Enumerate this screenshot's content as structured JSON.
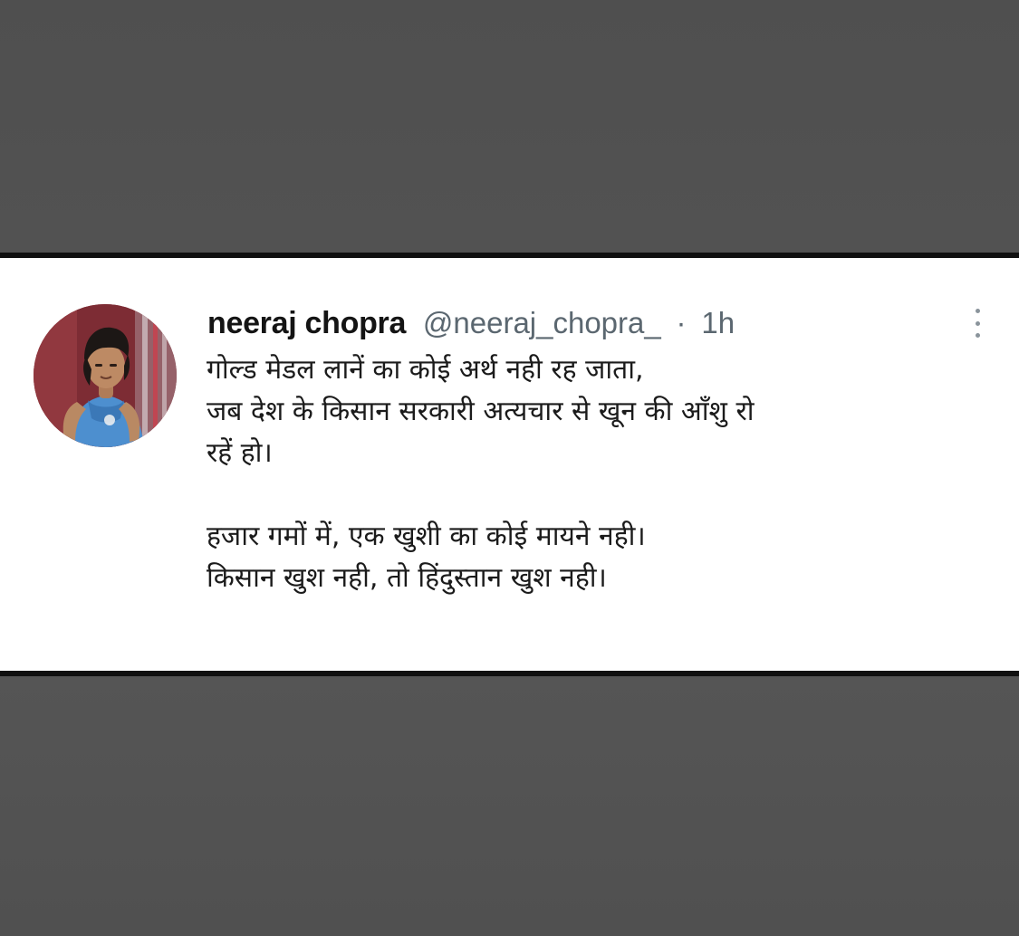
{
  "tweet": {
    "display_name": "neeraj chopra",
    "handle": "@neeraj_chopra_",
    "separator": "·",
    "time": "1h",
    "avatar_icon": "profile-avatar",
    "more_icon": "more-vertical-icon",
    "text_lines": [
      "गोल्ड मेडल लानें का कोई अर्थ नही रह जाता,",
      "जब देश के किसान सरकारी अत्यचार से खून की आँशु रो",
      "रहें हो।",
      "हजार गमों में, एक खुशी का कोई मायने नही।",
      "किसान खुश नही, तो हिंदुस्तान खुश नही।"
    ]
  },
  "colors": {
    "background": "#515151",
    "card": "#ffffff",
    "border": "#101010",
    "name_text": "#141414",
    "meta_text": "#5b6770",
    "body_text": "#1b1b1b"
  }
}
